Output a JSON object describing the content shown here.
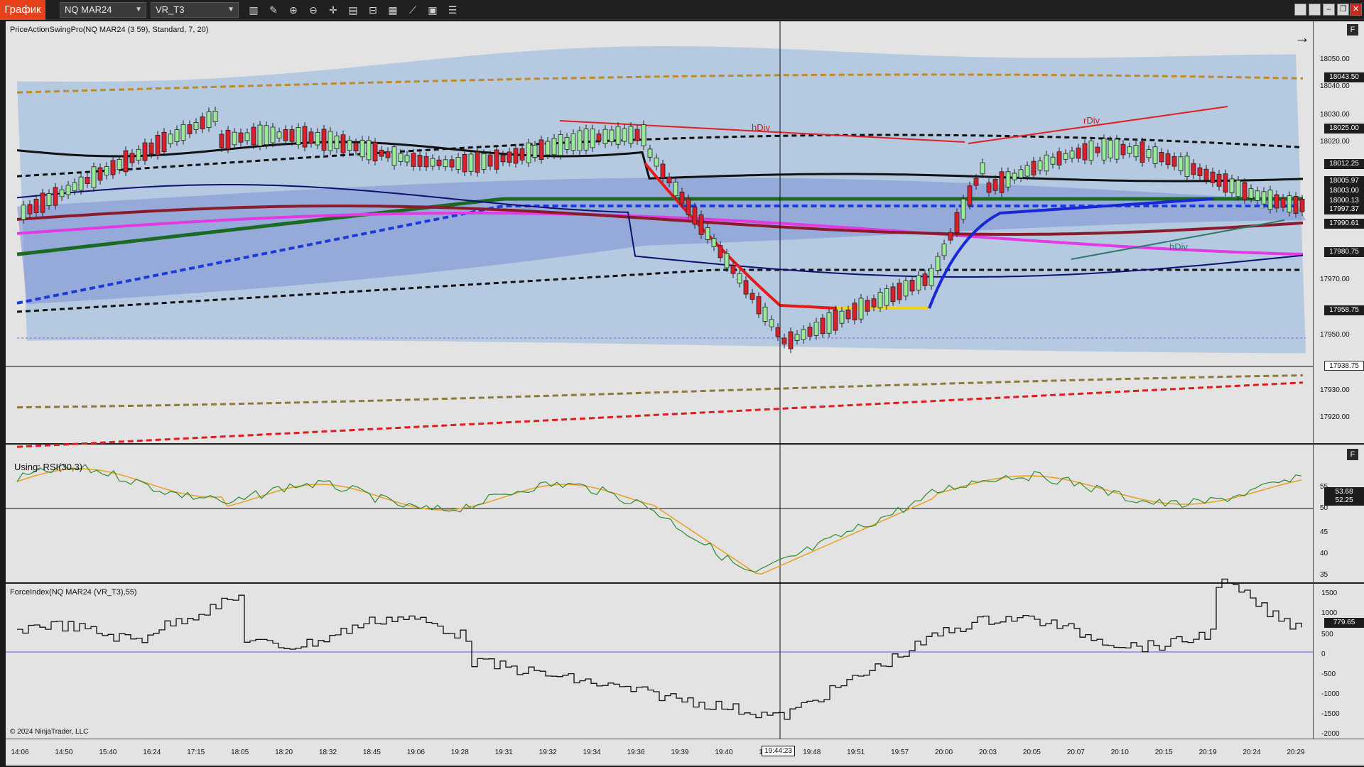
{
  "toolbar": {
    "app_badge": "График",
    "instrument": "NQ MAR24",
    "data_series": "VR_T3",
    "icons": [
      "bar-type-icon",
      "drawing-tool-icon",
      "zoom-in-icon",
      "zoom-out-icon",
      "crosshair-icon",
      "data-box-icon",
      "chart-trader-icon",
      "templates-icon",
      "strategies-icon",
      "properties-icon"
    ]
  },
  "window_controls": [
    "tile-icon",
    "copy-icon",
    "minimize-icon",
    "restore-icon",
    "close-icon"
  ],
  "price_panel": {
    "label": "PriceActionSwingPro(NQ MAR24 (3 59), Standard, 7, 20)",
    "f_button": "F",
    "arrow": "→",
    "y_ticks": [
      "18050.00",
      "18040.00",
      "18030.00",
      "18020.00",
      "17970.00",
      "17950.00",
      "17930.00",
      "17920.00"
    ],
    "price_tags": [
      "18043.50",
      "18025.00",
      "18012.25",
      "18005.97",
      "18003.00",
      "18000.13",
      "17997.37",
      "17990.61",
      "17980.75",
      "17958.75",
      "17938.75"
    ],
    "annotations": [
      "hDiv",
      "rDiv",
      "hDiv"
    ]
  },
  "rsi_panel": {
    "label": "Using: RSI(30,3)",
    "f_button": "F",
    "y_ticks": [
      "55",
      "50",
      "45",
      "40",
      "35"
    ],
    "price_tags": [
      "53.68",
      "52.25"
    ]
  },
  "force_panel": {
    "label": "ForceIndex(NQ MAR24 (VR_T3),55)",
    "y_ticks": [
      "1500",
      "1000",
      "500",
      "0",
      "-500",
      "-1000",
      "-1500",
      "-2000"
    ],
    "price_tag": "779.65"
  },
  "time_axis": {
    "labels": [
      "14:06",
      "14:50",
      "15:40",
      "16:24",
      "17:15",
      "18:05",
      "18:20",
      "18:32",
      "18:45",
      "19:06",
      "19:28",
      "19:31",
      "19:32",
      "19:34",
      "19:36",
      "19:39",
      "19:40",
      "19:42",
      "19:48",
      "19:51",
      "19:57",
      "20:00",
      "20:03",
      "20:05",
      "20:07",
      "20:10",
      "20:15",
      "20:19",
      "20:24",
      "20:29"
    ],
    "cursor_time": "19:44:23"
  },
  "copyright": "© 2024 NinjaTrader, LLC",
  "colors": {
    "badge": "#e8421c",
    "chart_bg": "#e3e3e3",
    "band": "#8fb4e0",
    "band_inner": "#7b8fd6",
    "up_candle": "#9aea9a",
    "down_candle": "#d81f2a",
    "rsi_line": "#2e8b2e",
    "rsi_signal": "#e8a020"
  }
}
